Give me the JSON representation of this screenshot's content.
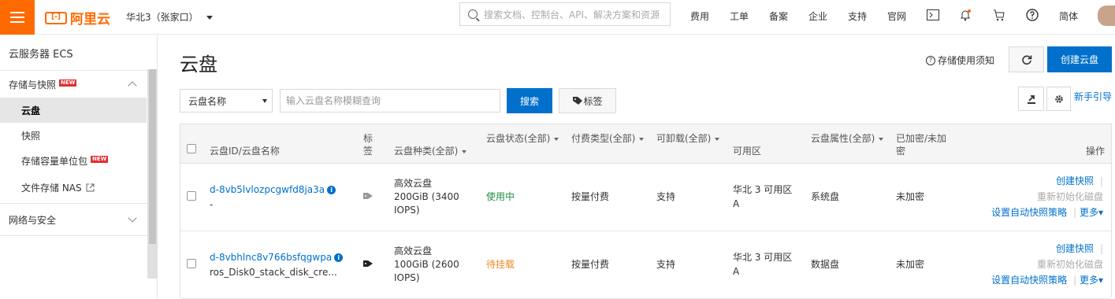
{
  "topbar": {
    "logo_text": "阿里云",
    "region": "华北3（张家口）",
    "search_placeholder": "搜索文档、控制台、API、解决方案和资源",
    "nav": [
      "费用",
      "工单",
      "备案",
      "企业",
      "支持",
      "官网"
    ],
    "lang": "简体"
  },
  "sidebar": {
    "title": "云服务器 ECS",
    "group_storage": "存储与快照",
    "new_badge": "NEW",
    "items": [
      "云盘",
      "快照",
      "存储容量单位包",
      "文件存储 NAS"
    ],
    "group_network": "网络与安全"
  },
  "main": {
    "title": "云盘",
    "notice": "存储使用须知",
    "create_button": "创建云盘",
    "filter_select": "云盘名称",
    "filter_placeholder": "输入云盘名称模糊查询",
    "search_button": "搜索",
    "tag_button": "标签",
    "guide_link": "新手引导"
  },
  "table": {
    "headers": {
      "id_name": "云盘ID/云盘名称",
      "tag": [
        "标",
        "签"
      ],
      "type": "云盘种类(全部)",
      "status": "云盘状态(全部)",
      "pay": "付费类型(全部)",
      "detach": "可卸载(全部)",
      "zone": "可用区",
      "attr": "云盘属性(全部)",
      "encrypt": [
        "已加密/未加",
        "密"
      ],
      "ops": "操作"
    },
    "rows": [
      {
        "id": "d-8vb5lvlozpcgwfd8ja3a",
        "name": "-",
        "type": [
          "高效云盘",
          "200GiB (3400",
          "IOPS)"
        ],
        "status": "使用中",
        "pay": "按量付费",
        "detach": "支持",
        "zone": [
          "华北 3 可用区",
          "A"
        ],
        "attr": "系统盘",
        "encrypt": "未加密",
        "op_snapshot": "创建快照",
        "op_reinit": "重新初始化磁盘",
        "op_policy": "设置自动快照策略",
        "op_more": "更多"
      },
      {
        "id": "d-8vbhlnc8v766bsfqgwpa",
        "name": "ros_Disk0_stack_disk_cre...",
        "type": [
          "高效云盘",
          "100GiB (2600",
          "IOPS)"
        ],
        "status": "待挂载",
        "pay": "按量付费",
        "detach": "支持",
        "zone": [
          "华北 3 可用区",
          "A"
        ],
        "attr": "数据盘",
        "encrypt": "未加密",
        "op_snapshot": "创建快照",
        "op_reinit": "重新初始化磁盘",
        "op_policy": "设置自动快照策略",
        "op_more": "更多"
      }
    ]
  },
  "colors": {
    "brand": "#ff6a00",
    "primary": "#0070cc",
    "in_use": "#1e8e3e",
    "pending": "#f08a24"
  }
}
